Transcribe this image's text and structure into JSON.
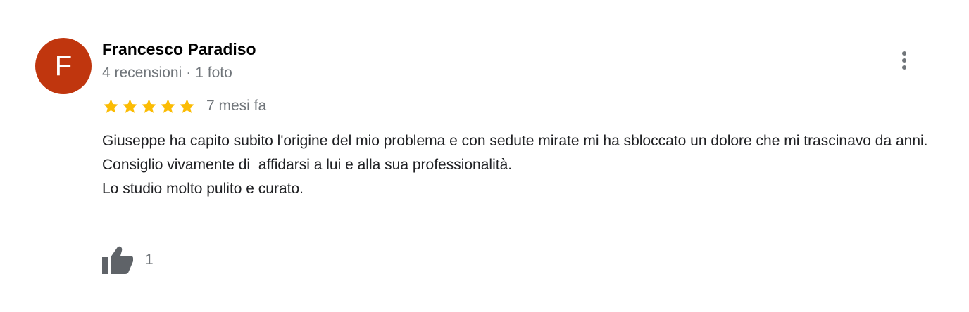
{
  "review": {
    "avatar_letter": "F",
    "avatar_color": "#c0360e",
    "author": "Francesco Paradiso",
    "reviews_count": "4 recensioni",
    "separator": "·",
    "photos_count": "1 foto",
    "rating": 5,
    "rating_max": 5,
    "star_color": "#fbbc04",
    "date": "7 mesi fa",
    "text_lines": [
      "Giuseppe ha capito subito l'origine del mio problema e con sedute mirate mi ha sbloccato un dolore che mi trascinavo da anni.",
      "Consiglio vivamente di  affidarsi a lui e alla sua professionalità.",
      "Lo studio molto pulito e curato."
    ],
    "like_count": "1",
    "icons": {
      "more": "more-vert-icon",
      "like": "thumb-up-icon",
      "star": "star-icon"
    }
  }
}
